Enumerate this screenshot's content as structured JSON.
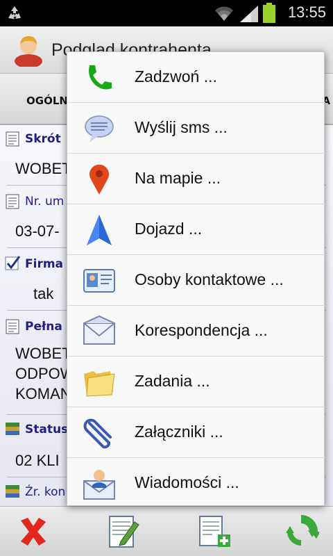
{
  "status_bar": {
    "time": "13:55"
  },
  "action_bar": {
    "title": "Podgląd kontrahenta"
  },
  "tabs": {
    "left": "OGÓLN",
    "right": "HA"
  },
  "fields": [
    {
      "label": "Skrót",
      "value": "WOBET",
      "label_style": "bold",
      "icon": "document-icon"
    },
    {
      "label": "Nr. um",
      "value": "03-07-",
      "label_style": "normal",
      "icon": "document-icon"
    },
    {
      "label": "Firma",
      "value": "tak",
      "label_style": "bold",
      "icon": "checkbox-icon"
    },
    {
      "label": "Pełna n",
      "value_lines": [
        "WOBET",
        "ODPOW",
        "KOMAN"
      ],
      "label_style": "bold",
      "icon": "document-icon"
    },
    {
      "label": "Status",
      "value": "02 KLI",
      "label_style": "bold",
      "icon": "books-icon"
    },
    {
      "label": "Źr. kon",
      "value": "",
      "label_style": "normal",
      "icon": "books-icon"
    }
  ],
  "menu": {
    "items": [
      {
        "label": "Zadzwoń ...",
        "icon": "phone-icon"
      },
      {
        "label": "Wyślij sms ...",
        "icon": "chat-bubble-icon"
      },
      {
        "label": "Na mapie ...",
        "icon": "map-pin-icon"
      },
      {
        "label": "Dojazd ...",
        "icon": "navigation-arrow-icon"
      },
      {
        "label": "Osoby kontaktowe ...",
        "icon": "contact-card-icon"
      },
      {
        "label": "Korespondencja ...",
        "icon": "envelope-icon"
      },
      {
        "label": "Zadania ...",
        "icon": "folder-icon"
      },
      {
        "label": "Załączniki ...",
        "icon": "paperclip-icon"
      },
      {
        "label": "Wiadomości ...",
        "icon": "message-user-icon"
      }
    ]
  },
  "bottom_bar": {
    "buttons": [
      {
        "name": "delete-button",
        "icon": "red-x-icon"
      },
      {
        "name": "edit-button",
        "icon": "edit-document-icon"
      },
      {
        "name": "add-document-button",
        "icon": "add-document-icon"
      },
      {
        "name": "refresh-button",
        "icon": "refresh-icon"
      }
    ]
  },
  "colors": {
    "accent_label": "#202080",
    "menu_background": "#f8f8f8",
    "statusbar": "#000000"
  }
}
